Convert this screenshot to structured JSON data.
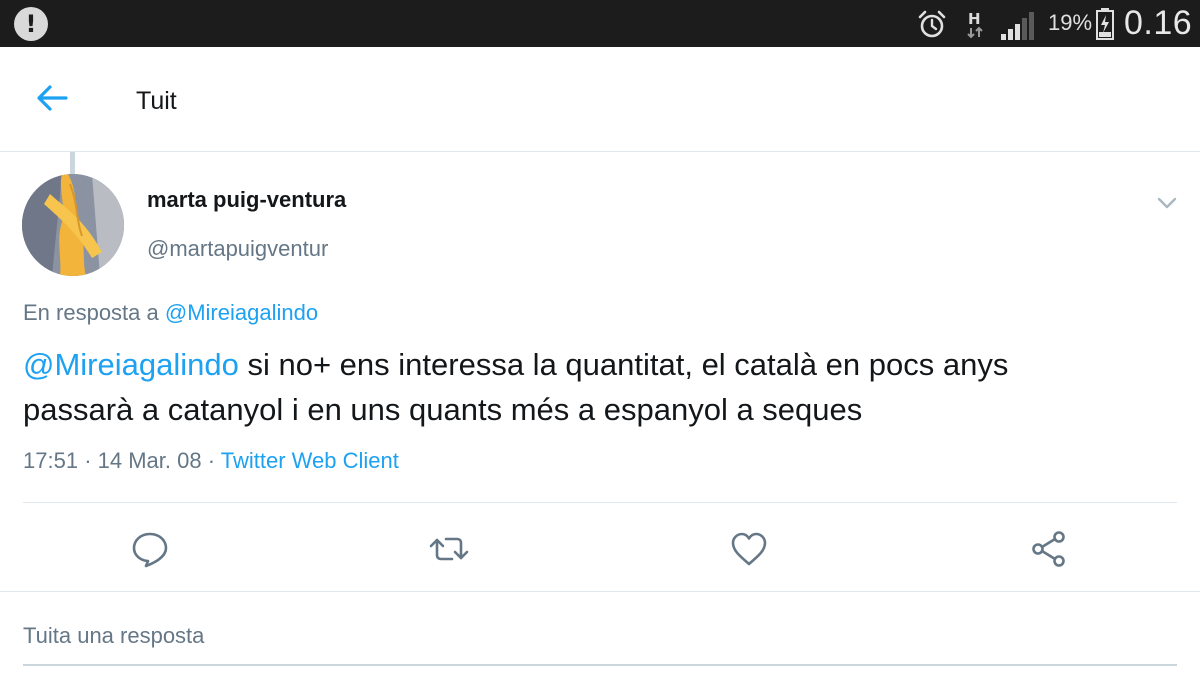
{
  "status_bar": {
    "alert_icon": "alert-circle-icon",
    "alarm_icon": "alarm-clock-icon",
    "network_icon": "hspa-network-icon",
    "signal_icon": "signal-bars-icon",
    "battery_percent": "19%",
    "battery_icon": "battery-charging-icon",
    "time": "0.16"
  },
  "header": {
    "back_icon": "arrow-left-icon",
    "title": "Tuit"
  },
  "tweet": {
    "author_name": "marta puig-ventura",
    "author_handle": "@martapuigventur",
    "reply_prefix": "En resposta a",
    "reply_target": "@Mireiagalindo",
    "mention": "@Mireiagalindo",
    "text_line1": "si no+ ens interessa la quantitat, el català en pocs anys",
    "text_line2": "passarà a catanyol i en uns quants més a espanyol a seques",
    "time": "17:51",
    "date": "14 Mar. 08",
    "separator": "·",
    "source": "Twitter Web Client"
  },
  "actions": {
    "reply_icon": "comment-icon",
    "retweet_icon": "retweet-icon",
    "like_icon": "heart-icon",
    "share_icon": "share-icon"
  },
  "reply_box": {
    "placeholder": "Tuita una resposta"
  },
  "colors": {
    "accent": "#1da1f2",
    "muted_text": "#657786",
    "status_bar_bg": "#1c1c1c",
    "divider": "#e1e8ed"
  }
}
